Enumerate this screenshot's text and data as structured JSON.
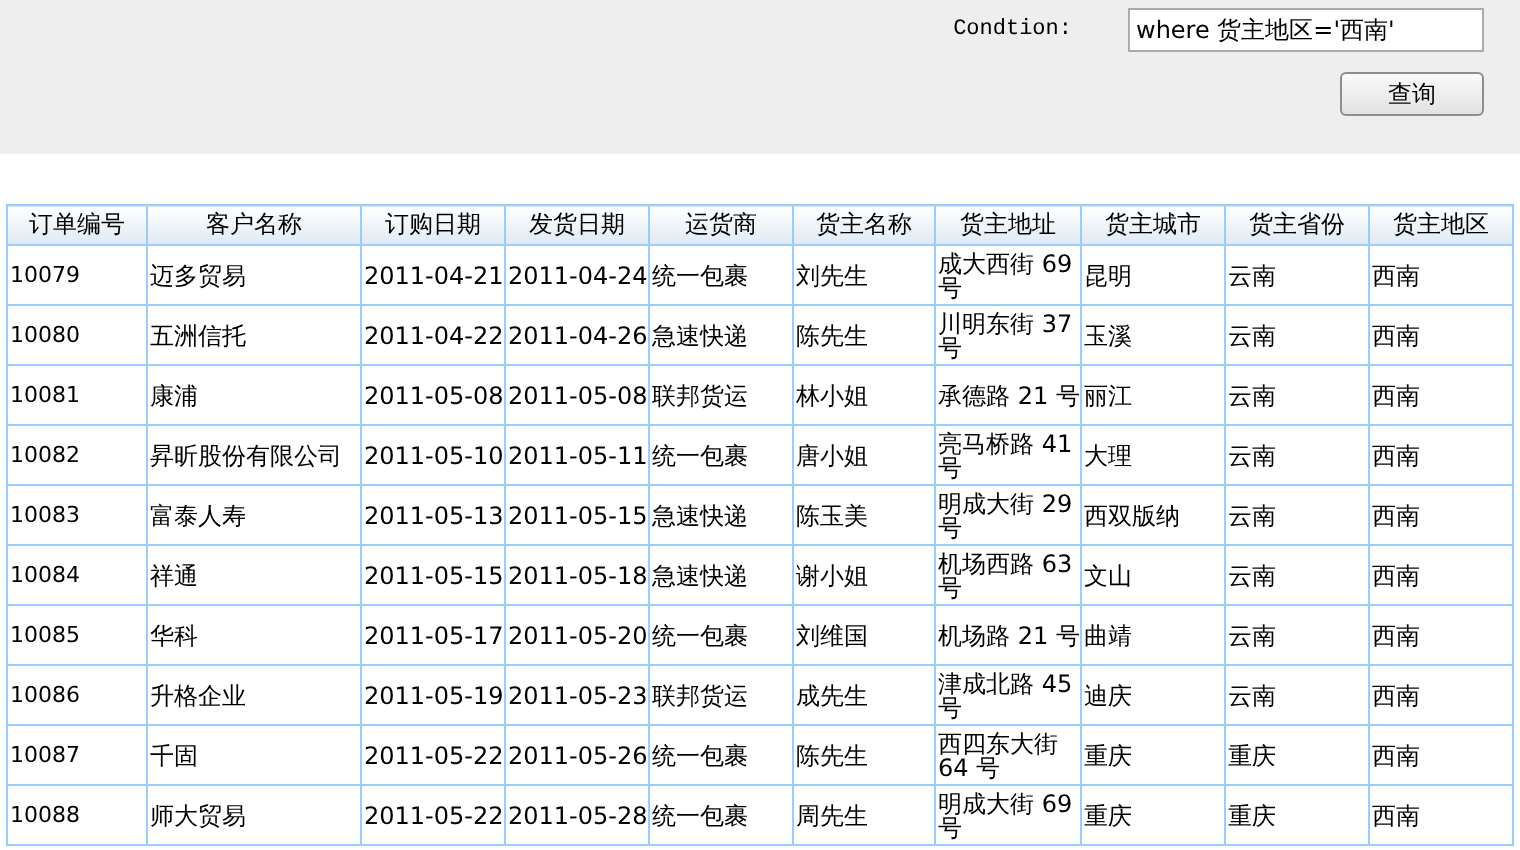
{
  "query": {
    "label": "Condtion:",
    "value": "where 货主地区='西南'",
    "button": "查询"
  },
  "table": {
    "columns": [
      "订单编号",
      "客户名称",
      "订购日期",
      "发货日期",
      "运货商",
      "货主名称",
      "货主地址",
      "货主城市",
      "货主省份",
      "货主地区"
    ],
    "rows": [
      [
        "10079",
        "迈多贸易",
        "2011-04-21",
        "2011-04-24",
        "统一包裹",
        "刘先生",
        "成大西街 69 号",
        "昆明",
        "云南",
        "西南"
      ],
      [
        "10080",
        "五洲信托",
        "2011-04-22",
        "2011-04-26",
        "急速快递",
        "陈先生",
        "川明东街 37 号",
        "玉溪",
        "云南",
        "西南"
      ],
      [
        "10081",
        "康浦",
        "2011-05-08",
        "2011-05-08",
        "联邦货运",
        "林小姐",
        "承德路 21 号",
        "丽江",
        "云南",
        "西南"
      ],
      [
        "10082",
        "昇昕股份有限公司",
        "2011-05-10",
        "2011-05-11",
        "统一包裹",
        "唐小姐",
        "亮马桥路 41 号",
        "大理",
        "云南",
        "西南"
      ],
      [
        "10083",
        "富泰人寿",
        "2011-05-13",
        "2011-05-15",
        "急速快递",
        "陈玉美",
        "明成大街 29 号",
        "西双版纳",
        "云南",
        "西南"
      ],
      [
        "10084",
        "祥通",
        "2011-05-15",
        "2011-05-18",
        "急速快递",
        "谢小姐",
        "机场西路 63 号",
        "文山",
        "云南",
        "西南"
      ],
      [
        "10085",
        "华科",
        "2011-05-17",
        "2011-05-20",
        "统一包裹",
        "刘维国",
        "机场路 21 号",
        "曲靖",
        "云南",
        "西南"
      ],
      [
        "10086",
        "升格企业",
        "2011-05-19",
        "2011-05-23",
        "联邦货运",
        "成先生",
        "津成北路 45 号",
        "迪庆",
        "云南",
        "西南"
      ],
      [
        "10087",
        "千固",
        "2011-05-22",
        "2011-05-26",
        "统一包裹",
        "陈先生",
        "西四东大街 64 号",
        "重庆",
        "重庆",
        "西南"
      ],
      [
        "10088",
        "师大贸易",
        "2011-05-22",
        "2011-05-28",
        "统一包裹",
        "周先生",
        "明成大街 69 号",
        "重庆",
        "重庆",
        "西南"
      ]
    ]
  }
}
